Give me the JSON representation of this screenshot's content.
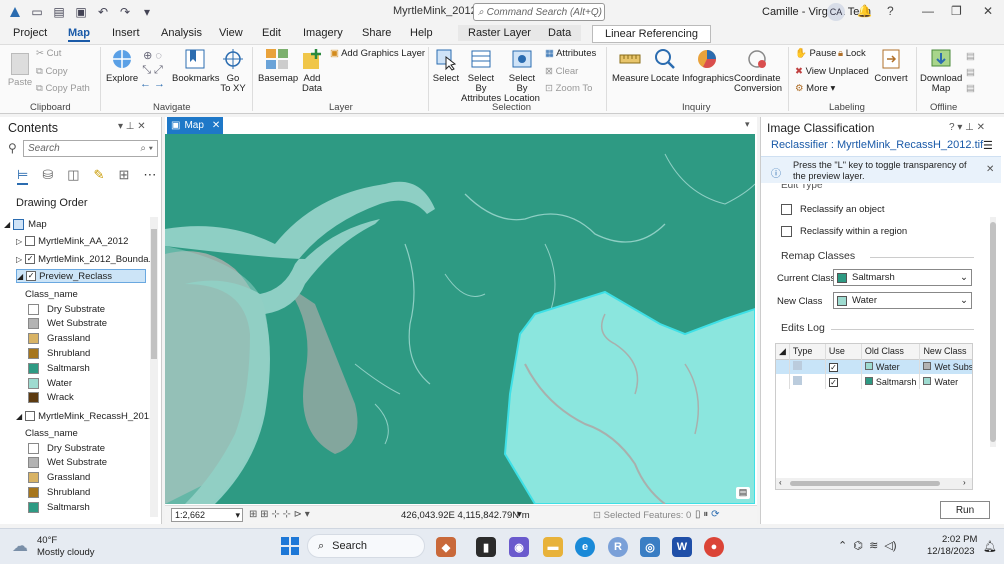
{
  "app": {
    "title": "MyrtleMink_2012",
    "command_search_placeholder": "Command Search (Alt+Q)",
    "user_name": "Camille - Virginia Tech",
    "user_initials": "CA"
  },
  "ribbon_tabs": [
    "Project",
    "Map",
    "Insert",
    "Analysis",
    "View",
    "Edit",
    "Imagery",
    "Share",
    "Help",
    "Raster Layer",
    "Data",
    "Linear Referencing"
  ],
  "ribbon": {
    "clipboard": {
      "group": "Clipboard",
      "paste": "Paste",
      "cut": "Cut",
      "copy": "Copy",
      "copy_path": "Copy Path"
    },
    "navigate": {
      "group": "Navigate",
      "explore": "Explore",
      "bookmarks": "Bookmarks",
      "goto_1": "Go",
      "goto_2": "To XY"
    },
    "layer": {
      "group": "Layer",
      "basemap": "Basemap",
      "add_data_1": "Add",
      "add_data_2": "Data",
      "add_graphics": "Add Graphics Layer"
    },
    "selection": {
      "group": "Selection",
      "select": "Select",
      "select_by_attr_1": "Select By",
      "select_by_attr_2": "Attributes",
      "select_by_loc_1": "Select By",
      "select_by_loc_2": "Location",
      "attributes": "Attributes",
      "clear": "Clear",
      "zoom_to": "Zoom To"
    },
    "inquiry": {
      "group": "Inquiry",
      "measure": "Measure",
      "locate": "Locate",
      "infographics": "Infographics",
      "coord_1": "Coordinate",
      "coord_2": "Conversion"
    },
    "labeling": {
      "group": "Labeling",
      "pause": "Pause",
      "lock": "Lock",
      "view_unplaced": "View Unplaced",
      "more": "More",
      "convert": "Convert"
    },
    "offline": {
      "group": "Offline",
      "download_1": "Download",
      "download_2": "Map"
    }
  },
  "contents": {
    "title": "Contents",
    "search_placeholder": "Search",
    "drawing_order": "Drawing Order",
    "map_label": "Map",
    "layers": [
      {
        "name": "MyrtleMink_AA_2012",
        "checked": false
      },
      {
        "name": "MyrtleMink_2012_Bounda...",
        "checked": true
      },
      {
        "name": "Preview_Reclass",
        "checked": true
      },
      {
        "name": "MyrtleMink_RecassH_201...",
        "checked": false
      }
    ],
    "class_name": "Class_name",
    "legend1": [
      {
        "label": "Dry Substrate",
        "color": "#ffffff"
      },
      {
        "label": "Wet Substrate",
        "color": "#b3b3b3"
      },
      {
        "label": "Grassland",
        "color": "#d8b365"
      },
      {
        "label": "Shrubland",
        "color": "#a6761d"
      },
      {
        "label": "Saltmarsh",
        "color": "#2e9a83"
      },
      {
        "label": "Water",
        "color": "#9edbd0"
      },
      {
        "label": "Wrack",
        "color": "#5c3a10"
      }
    ],
    "legend2": [
      {
        "label": "Dry Substrate",
        "color": "#ffffff"
      },
      {
        "label": "Wet Substrate",
        "color": "#b3b3b3"
      },
      {
        "label": "Grassland",
        "color": "#d8b365"
      },
      {
        "label": "Shrubland",
        "color": "#a6761d"
      },
      {
        "label": "Saltmarsh",
        "color": "#2e9a83"
      }
    ]
  },
  "map": {
    "tab_label": "Map",
    "scale": "1:2,662",
    "coordinates": "426,043.92E 4,115,842.79N m",
    "selected_features": "Selected Features: 0"
  },
  "image_classification": {
    "title": "Image Classification",
    "subtitle": "Reclassifier : MyrtleMink_RecassH_2012.tif",
    "info": "Press the \"L\" key to toggle transparency of the preview layer.",
    "edit_type_heading": "Edit Type",
    "reclassify_object": "Reclassify an object",
    "reclassify_region": "Reclassify within a region",
    "remap_heading": "Remap Classes",
    "current_class_label": "Current Class",
    "current_class_value": "Saltmarsh",
    "new_class_label": "New Class",
    "new_class_value": "Water",
    "edits_log_heading": "Edits Log",
    "log_columns": [
      "Type",
      "Use",
      "Old Class",
      "New Class"
    ],
    "log_rows": [
      {
        "old": "Water",
        "new": "Wet Subs",
        "old_color": "#9edbd0",
        "new_color": "#b3b3b3"
      },
      {
        "old": "Saltmarsh",
        "new": "Water",
        "old_color": "#2e9a83",
        "new_color": "#9edbd0"
      }
    ],
    "run_button": "Run"
  },
  "taskbar": {
    "weather_temp": "40°F",
    "weather_desc": "Mostly cloudy",
    "search": "Search",
    "time": "2:02 PM",
    "date": "12/18/2023"
  },
  "colors": {
    "saltmarsh": "#2e9a83",
    "water": "#9edbd0",
    "wet_substrate": "#b3b3b3",
    "accent": "#1a5aa8"
  }
}
